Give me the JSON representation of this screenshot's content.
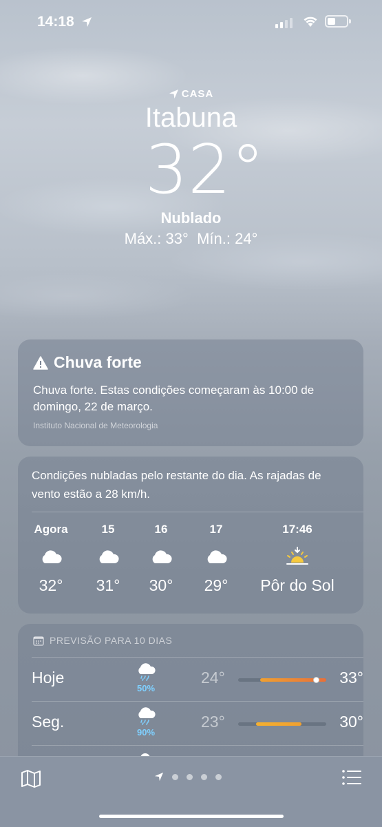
{
  "status_bar": {
    "time": "14:18"
  },
  "header": {
    "location_tag": "CASA",
    "city": "Itabuna",
    "temperature": "32°",
    "condition": "Nublado",
    "max_label": "Máx.:",
    "max": "33°",
    "min_label": "Mín.:",
    "min": "24°"
  },
  "alert": {
    "title": "Chuva forte",
    "body": "Chuva forte. Estas condições começaram às 10:00 de domingo, 22 de março.",
    "source": "Instituto Nacional de Meteorologia"
  },
  "hourly": {
    "summary": "Condições nubladas pelo restante do dia. As rajadas de vento estão a 28 km/h.",
    "items": [
      {
        "label": "Agora",
        "icon": "cloud-icon",
        "value": "32°"
      },
      {
        "label": "15",
        "icon": "cloud-icon",
        "value": "31°"
      },
      {
        "label": "16",
        "icon": "cloud-icon",
        "value": "30°"
      },
      {
        "label": "17",
        "icon": "cloud-icon",
        "value": "29°"
      },
      {
        "label": "17:46",
        "icon": "sunset-icon",
        "value": "Pôr do Sol"
      }
    ]
  },
  "daily": {
    "header": "PREVISÃO PARA 10 DIAS",
    "days": [
      {
        "day": "Hoje",
        "icon": "cloud-rain-icon",
        "precip": "50%",
        "low": "24°",
        "high": "33°",
        "range_start": 0.25,
        "range_end": 1.0,
        "current": 0.88,
        "colors": [
          "#f0a030",
          "#e8703a"
        ]
      },
      {
        "day": "Seg.",
        "icon": "cloud-rain-icon",
        "precip": "90%",
        "low": "23°",
        "high": "30°",
        "range_start": 0.2,
        "range_end": 0.72,
        "colors": [
          "#f5b030",
          "#f0a030"
        ]
      }
    ]
  },
  "tabbar": {
    "pages": 4,
    "active": "location-arrow-icon"
  }
}
